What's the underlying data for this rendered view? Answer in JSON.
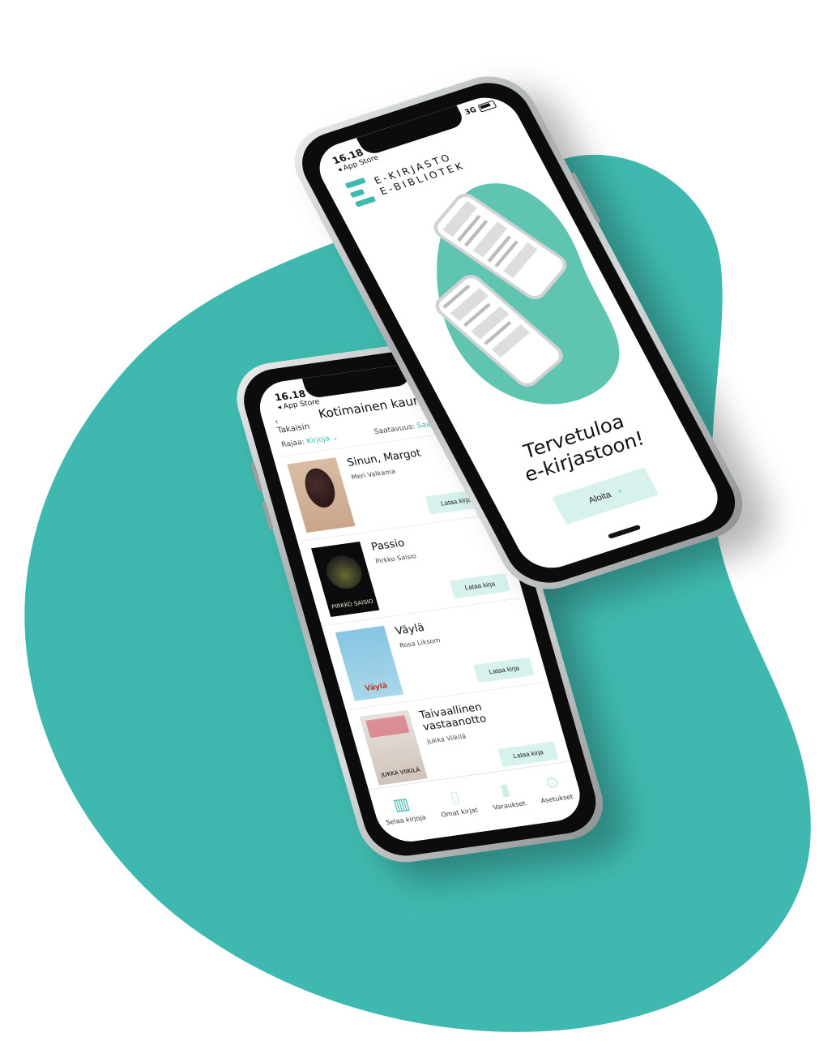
{
  "colors": {
    "teal": "#3dbbb0",
    "mint": "#d7f1ec",
    "phone_frame": "#b7babb"
  },
  "welcome_phone": {
    "status": {
      "time": "16.18",
      "back_app": "◂ App Store",
      "signal": "3G"
    },
    "brand": {
      "line1": "E-KIRJASTO",
      "line2": "E-BIBLIOTEK",
      "icon": "e-logo-icon"
    },
    "greeting_line1": "Tervetuloa",
    "greeting_line2": "e-kirjastoon!",
    "start_button": {
      "label": "Aloita",
      "icon": "chevron-right-icon",
      "glyph": "›"
    }
  },
  "list_phone": {
    "status": {
      "time": "16.18",
      "back_app": "◂ App Store"
    },
    "nav": {
      "back_label": "‹ Takaisin",
      "title": "Kotimainen kaunokirja"
    },
    "filters": {
      "filter_label": "Rajaa:",
      "filter_value": "Kirjoja ⌄",
      "sort_label": "Saatavuus:",
      "sort_value": "Saatavilla ⌄"
    },
    "books": [
      {
        "title": "Sinun, Margot",
        "author": "Meri Valkama",
        "button": "Lataa kirja",
        "cover_text": ""
      },
      {
        "title": "Passio",
        "author": "Pirkko Saisio",
        "button": "Lataa kirja",
        "cover_text": "PIRKKO SAISIO"
      },
      {
        "title": "Väylä",
        "author": "Rosa Liksom",
        "button": "Lataa kirja",
        "cover_text": "Väylä"
      },
      {
        "title": "Taivaallinen vastaanotto",
        "author": "Jukka Viikilä",
        "button": "Lataa kirja",
        "cover_text": "JUKKA VIIKILÄ"
      }
    ],
    "tabs": [
      {
        "label": "Selaa kirjoja",
        "icon": "books-icon",
        "glyph": "▥",
        "active": true
      },
      {
        "label": "Omat kirjat",
        "icon": "open-book-icon",
        "glyph": "▯",
        "active": false
      },
      {
        "label": "Varaukset",
        "icon": "bookmark-icon",
        "glyph": "▮",
        "active": false
      },
      {
        "label": "Asetukset",
        "icon": "gear-icon",
        "glyph": "⚙",
        "active": false
      }
    ]
  }
}
